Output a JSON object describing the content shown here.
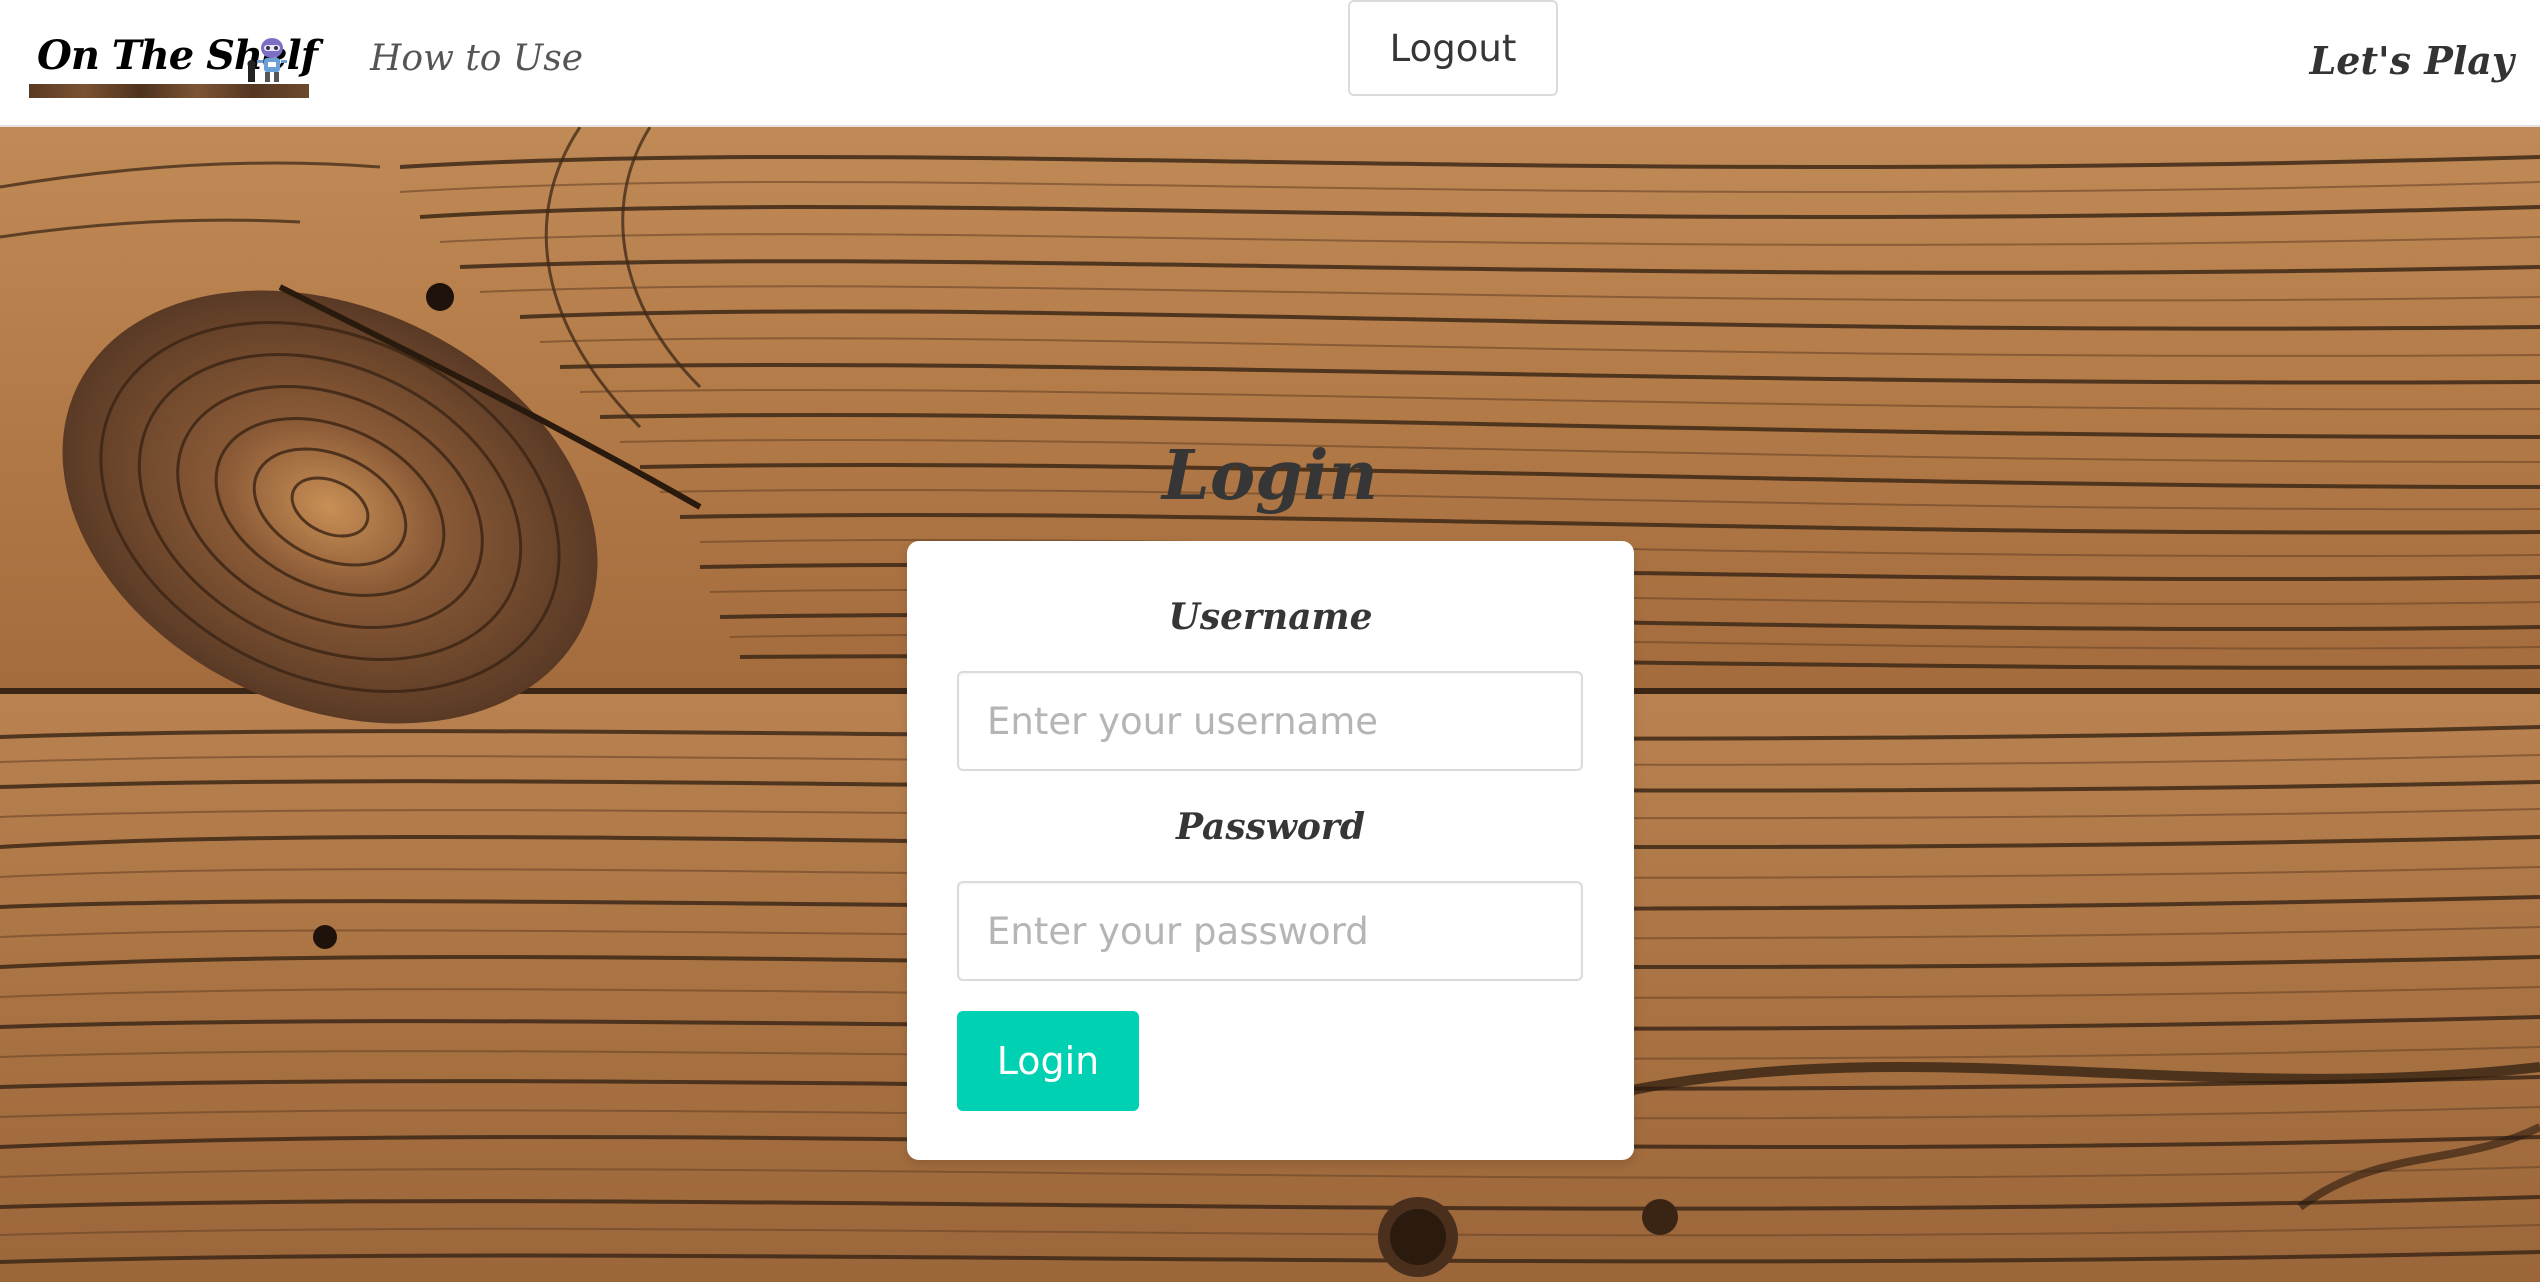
{
  "navbar": {
    "logo_text": "On The Shelf",
    "how_to_use": "How to Use",
    "logout": "Logout",
    "lets_play": "Let's Play"
  },
  "login": {
    "title": "Login",
    "username_label": "Username",
    "username_placeholder": "Enter your username",
    "username_value": "",
    "password_label": "Password",
    "password_placeholder": "Enter your password",
    "password_value": "",
    "submit_label": "Login"
  },
  "colors": {
    "primary": "#00d1b2",
    "text": "#363636",
    "border": "#dbdbdb",
    "background_wood": "#b07a4a"
  },
  "icons": {
    "logo_mascot": "robot-icon"
  }
}
